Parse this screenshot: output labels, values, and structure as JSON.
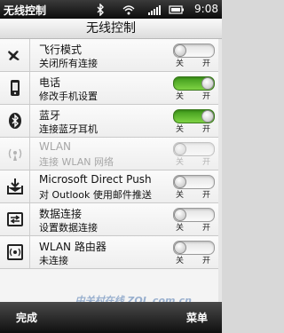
{
  "status_bar": {
    "title": "无线控制",
    "time": "9:08",
    "icons": [
      "bluetooth-icon",
      "wifi-icon",
      "signal-icon",
      "battery-icon"
    ]
  },
  "header": {
    "title": "无线控制"
  },
  "rows": [
    {
      "name": "飞行模式",
      "desc": "关闭所有连接",
      "state": "off",
      "enabled": true,
      "icon": "airplane-icon"
    },
    {
      "name": "电话",
      "desc": "修改手机设置",
      "state": "on",
      "enabled": true,
      "icon": "phone-icon"
    },
    {
      "name": "蓝牙",
      "desc": "连接蓝牙耳机",
      "state": "on",
      "enabled": true,
      "icon": "bluetooth-icon"
    },
    {
      "name": "WLAN",
      "desc": "连接 WLAN 网络",
      "state": "off",
      "enabled": false,
      "icon": "wifi-antenna-icon"
    },
    {
      "name": "Microsoft Direct Push",
      "desc": "对 Outlook 使用邮件推送",
      "state": "off",
      "enabled": true,
      "icon": "mail-download-icon"
    },
    {
      "name": "数据连接",
      "desc": "设置数据连接",
      "state": "off",
      "enabled": true,
      "icon": "data-connection-icon"
    },
    {
      "name": "WLAN 路由器",
      "desc": "未连接",
      "state": "off",
      "enabled": true,
      "icon": "router-icon"
    }
  ],
  "toggle_labels": {
    "off": "关",
    "on": "开"
  },
  "bottom_bar": {
    "left": "完成",
    "right": "菜单"
  },
  "watermark": "中关村在线 ZOL.com.cn",
  "colors": {
    "toggle_on": "#5cb82c",
    "status_bar": "#111111",
    "header_bg": "#eeeeee"
  }
}
